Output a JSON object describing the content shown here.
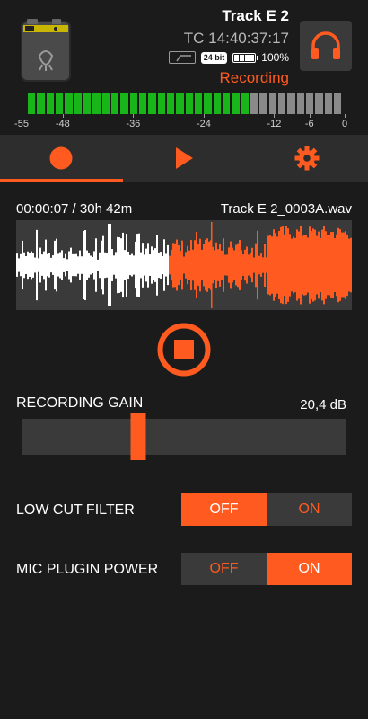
{
  "header": {
    "track_name": "Track E 2",
    "timecode": "TC 14:40:37:17",
    "bit_depth": "24 bit",
    "battery_percent": "100%",
    "battery_level": 1.0,
    "status": "Recording",
    "headphones_icon": "headphones-icon",
    "device_icon": "recorder-device-icon"
  },
  "meter": {
    "scale": [
      "-55",
      "-48",
      "-36",
      "-24",
      "-12",
      "-6",
      "0"
    ],
    "scale_values": [
      -55,
      -48,
      -36,
      -24,
      -12,
      -6,
      0
    ],
    "range": [
      -55,
      0
    ],
    "segments_total": 34,
    "segments_lit": 24,
    "lit_color": "#19b619",
    "unlit_color": "#8a8a8a"
  },
  "tabs": [
    {
      "name": "record",
      "icon": "record-icon",
      "active": true
    },
    {
      "name": "play",
      "icon": "play-icon",
      "active": false
    },
    {
      "name": "settings",
      "icon": "gear-icon",
      "active": false
    }
  ],
  "recording": {
    "elapsed_remaining": "00:00:07 / 30h 42m",
    "file_name": "Track E 2_0003A.wav",
    "stop_icon": "stop-icon"
  },
  "gain": {
    "label": "RECORDING GAIN",
    "value_text": "20,4 dB",
    "slider_fraction": 0.36
  },
  "options": [
    {
      "label": "LOW CUT FILTER",
      "off_label": "OFF",
      "on_label": "ON",
      "state": "OFF"
    },
    {
      "label": "MIC PLUGIN POWER",
      "off_label": "OFF",
      "on_label": "ON",
      "state": "ON"
    }
  ],
  "colors": {
    "accent": "#ff5a1f",
    "background": "#1b1b1b",
    "panel": "#3a3a3a",
    "tabbar": "#2d2d2d"
  }
}
